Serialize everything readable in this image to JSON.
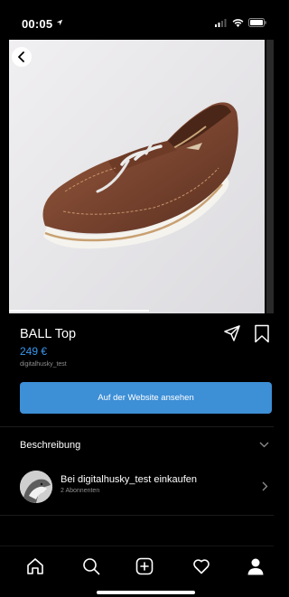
{
  "status_bar": {
    "time": "00:05",
    "location_icon": "location-arrow-icon",
    "signal_icon": "signal-icon",
    "wifi_icon": "wifi-icon",
    "battery_icon": "battery-icon"
  },
  "product": {
    "title": "BALL Top",
    "price": "249 €",
    "shop_handle": "digitalhusky_test",
    "image_icon": "brown-sneaker-image",
    "image_position": {
      "current": 1,
      "fraction_viewed": 0.55
    }
  },
  "actions": {
    "website_button_label": "Auf der Website ansehen"
  },
  "description": {
    "label": "Beschreibung"
  },
  "shop": {
    "label": "Bei digitalhusky_test einkaufen",
    "followers": "2 Abonnenten"
  },
  "tab_bar": {
    "items": [
      "home-icon",
      "search-icon",
      "add-icon",
      "heart-icon",
      "profile-icon"
    ]
  },
  "colors": {
    "accent": "#3897f0",
    "button": "#3d8fd6",
    "background": "#000000",
    "muted": "#8e8e8e"
  }
}
